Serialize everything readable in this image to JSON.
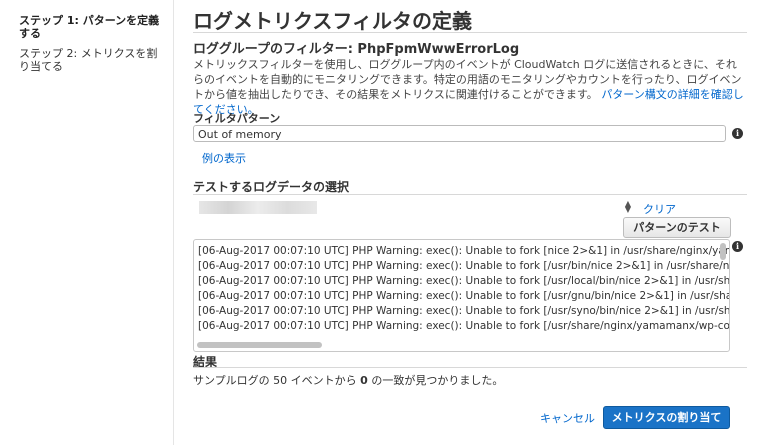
{
  "sidebar": {
    "steps": [
      {
        "label": "ステップ 1: パターンを定義する",
        "active": true
      },
      {
        "label": "ステップ 2: メトリクスを割り当てる",
        "active": false
      }
    ]
  },
  "page": {
    "title": "ログメトリクスフィルタの定義",
    "subtitle": "ロググループのフィルター: PhpFpmWwwErrorLog",
    "description": "メトリックスフィルターを使用し、ロググループ内のイベントが CloudWatch ログに送信されるときに、それらのイベントを自動的にモニタリングできます。特定の用語のモニタリングやカウントを行ったり、ログイベントから値を抽出したりでき、その結果をメトリクスに関連付けることができます。",
    "description_link": "パターン構文の詳細を確認してください。"
  },
  "filter": {
    "label": "フィルタパターン",
    "value": "Out of memory",
    "examples_link": "例の表示"
  },
  "test": {
    "title": "テストするログデータの選択",
    "clear_link": "クリア",
    "test_button": "パターンのテスト",
    "log_lines": [
      "[06-Aug-2017 00:07:10 UTC] PHP Warning:  exec(): Unable to fork [nice 2>&1] in /usr/share/nginx/yama",
      "[06-Aug-2017 00:07:10 UTC] PHP Warning:  exec(): Unable to fork [/usr/bin/nice 2>&1] in /usr/share/ngi",
      "[06-Aug-2017 00:07:10 UTC] PHP Warning:  exec(): Unable to fork [/usr/local/bin/nice 2>&1] in /usr/sha",
      "[06-Aug-2017 00:07:10 UTC] PHP Warning:  exec(): Unable to fork [/usr/gnu/bin/nice 2>&1] in /usr/share",
      "[06-Aug-2017 00:07:10 UTC] PHP Warning:  exec(): Unable to fork [/usr/syno/bin/nice 2>&1] in /usr/share",
      "[06-Aug-2017 00:07:10 UTC] PHP Warning:  exec(): Unable to fork [/usr/share/nginx/yamamanx/wp-con"
    ]
  },
  "result": {
    "title": "結果",
    "text_prefix": "サンプルログの ",
    "sample_count": "50",
    "text_middle": " イベントから ",
    "match_count": "0",
    "text_suffix": " の一致が見つかりました。"
  },
  "footer": {
    "cancel": "キャンセル",
    "submit": "メトリクスの割り当て"
  },
  "colors": {
    "accent": "#1a73c7",
    "link": "#0066cc"
  }
}
